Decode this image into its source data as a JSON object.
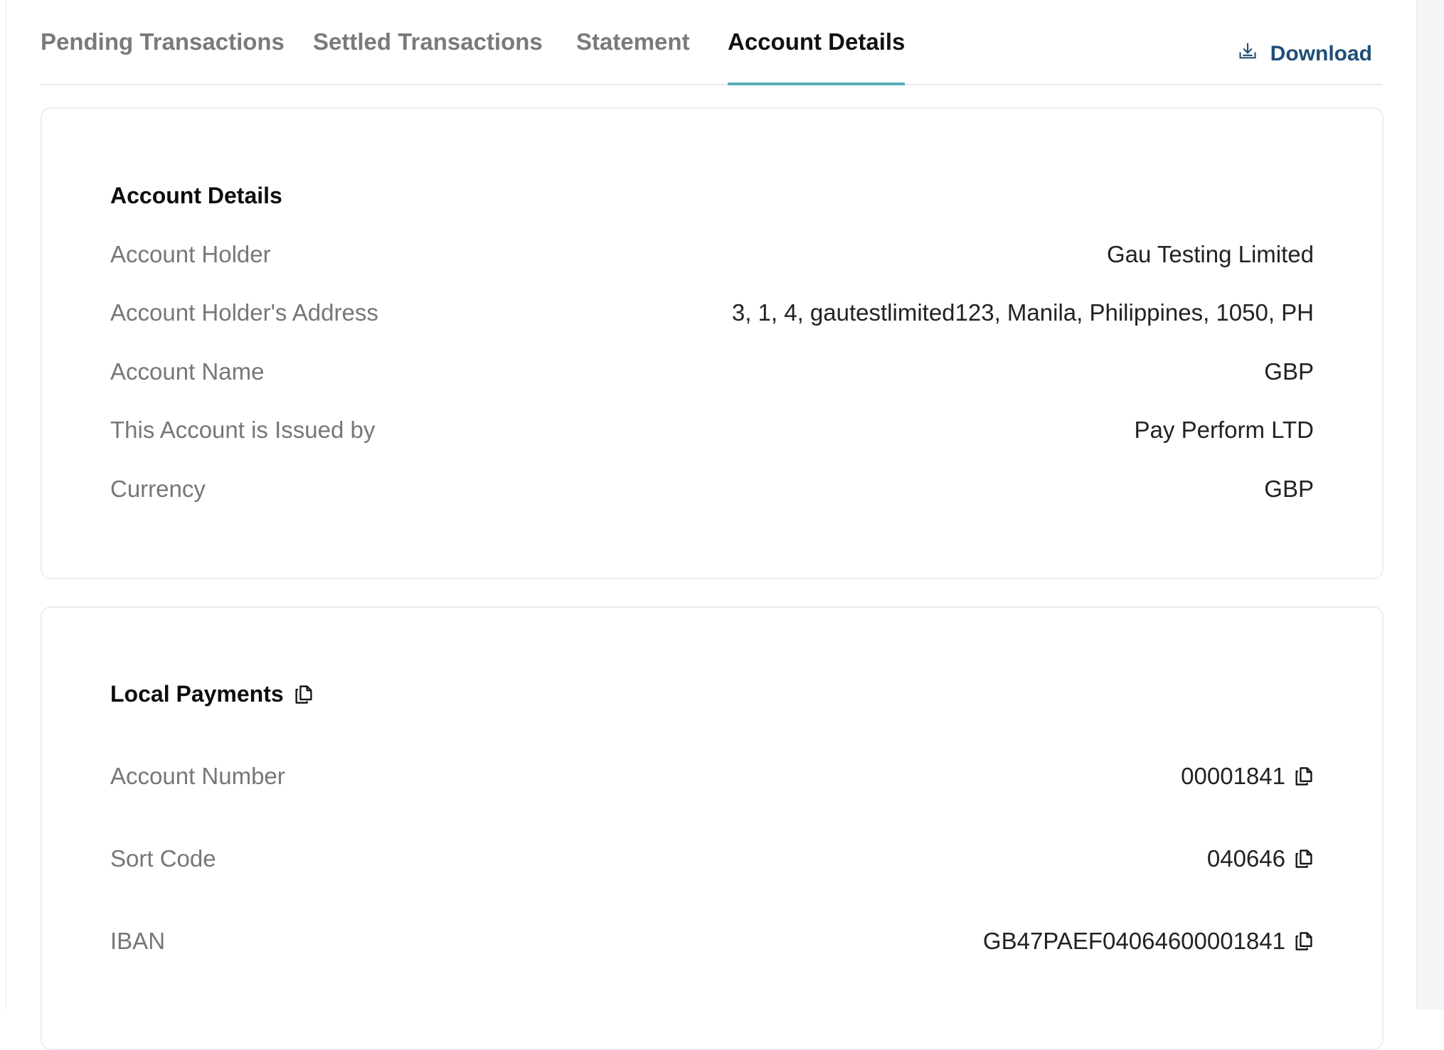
{
  "tabs": [
    {
      "label": "Pending Transactions",
      "active": false
    },
    {
      "label": "Settled Transactions",
      "active": false
    },
    {
      "label": "Statement",
      "active": false
    },
    {
      "label": "Account Details",
      "active": true
    }
  ],
  "download": {
    "label": "Download",
    "icon": "download-icon"
  },
  "account_details": {
    "title": "Account Details",
    "rows": [
      {
        "label": "Account Holder",
        "value": "Gau Testing Limited"
      },
      {
        "label": "Account Holder's Address",
        "value": "3, 1, 4, gautestlimited123, Manila, Philippines, 1050, PH"
      },
      {
        "label": "Account Name",
        "value": "GBP"
      },
      {
        "label": "This Account is Issued by",
        "value": "Pay Perform LTD"
      },
      {
        "label": "Currency",
        "value": "GBP"
      }
    ]
  },
  "local_payments": {
    "title": "Local Payments",
    "title_icon": "copy-icon",
    "rows": [
      {
        "label": "Account Number",
        "value": "00001841"
      },
      {
        "label": "Sort Code",
        "value": "040646"
      },
      {
        "label": "IBAN",
        "value": "GB47PAEF04064600001841"
      }
    ]
  },
  "colors": {
    "accent_underline": "#5aaebc",
    "download_text": "#1f4e79"
  }
}
